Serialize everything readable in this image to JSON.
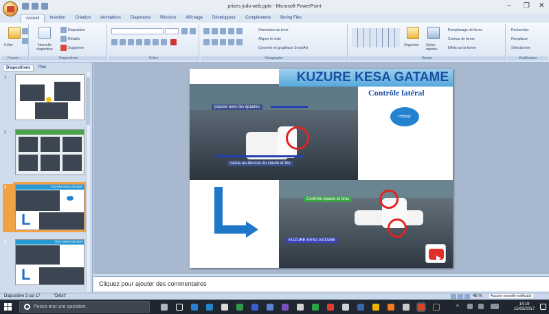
{
  "window": {
    "title": "prises judo web.pptx - Microsoft PowerPoint",
    "controls": [
      "–",
      "❐",
      "✕"
    ]
  },
  "ribbon": {
    "tabs": [
      "Accueil",
      "Insertion",
      "Création",
      "Animations",
      "Diaporama",
      "Révision",
      "Affichage",
      "Développeur",
      "Compléments",
      "Boring Fleo"
    ],
    "clipboard": {
      "label": "Presse-...",
      "paste": "Coller"
    },
    "slides": {
      "label": "Diapositives",
      "new_slide": "Nouvelle diapositive",
      "layout": "Disposition",
      "reset": "Rétablir",
      "delete": "Supprimer"
    },
    "font": {
      "label": "Police"
    },
    "paragraph": {
      "label": "Paragraphe",
      "orientation": "Orientation du texte",
      "align": "Aligner le texte",
      "smartart": "Convertir en graphique SmartArt"
    },
    "drawing": {
      "label": "Dessin",
      "arrange": "Organiser",
      "styles": "Styles rapides",
      "fill": "Remplissage de forme",
      "outline": "Contour de forme",
      "effects": "Effets sur la forme"
    },
    "editing": {
      "label": "Modification",
      "find": "Rechercher",
      "replace": "Remplacer",
      "select": "Sélectionner"
    }
  },
  "pane": {
    "tabs": [
      "Diapositives",
      "Plan"
    ],
    "thumb_numbers": [
      "1",
      "2",
      "3",
      "4"
    ],
    "thumb3_title": "KUZURE KESA GATAME",
    "thumb4_title": "TATE SHIHO GATAME"
  },
  "slide": {
    "title": "KUZURE KESA GATAME",
    "subtitle": "Contrôle latéral",
    "button": "retour",
    "label_top": "pousse avec les épaules",
    "label_bottom": "saisie au-dessus du coude et tire",
    "label_green": "Contrôle épaule et bras",
    "label_blue": "KUZURE KESA GATAME"
  },
  "notes": {
    "placeholder": "Cliquez pour ajouter des commentaires"
  },
  "status": {
    "slide": "Diapositive 3 sur 17",
    "theme": "\"Débit\"",
    "zoom": "46 %",
    "notification": "Aucune nouvelle notificatio"
  },
  "taskbar": {
    "search": "Posez-moi une question.",
    "time": "14:19",
    "date": "15/03/2017"
  },
  "colors": {
    "accent": "#1f77c9",
    "title_bar": "#55a9dc",
    "selection": "#f2a245",
    "taskbar": "#1f2630"
  }
}
